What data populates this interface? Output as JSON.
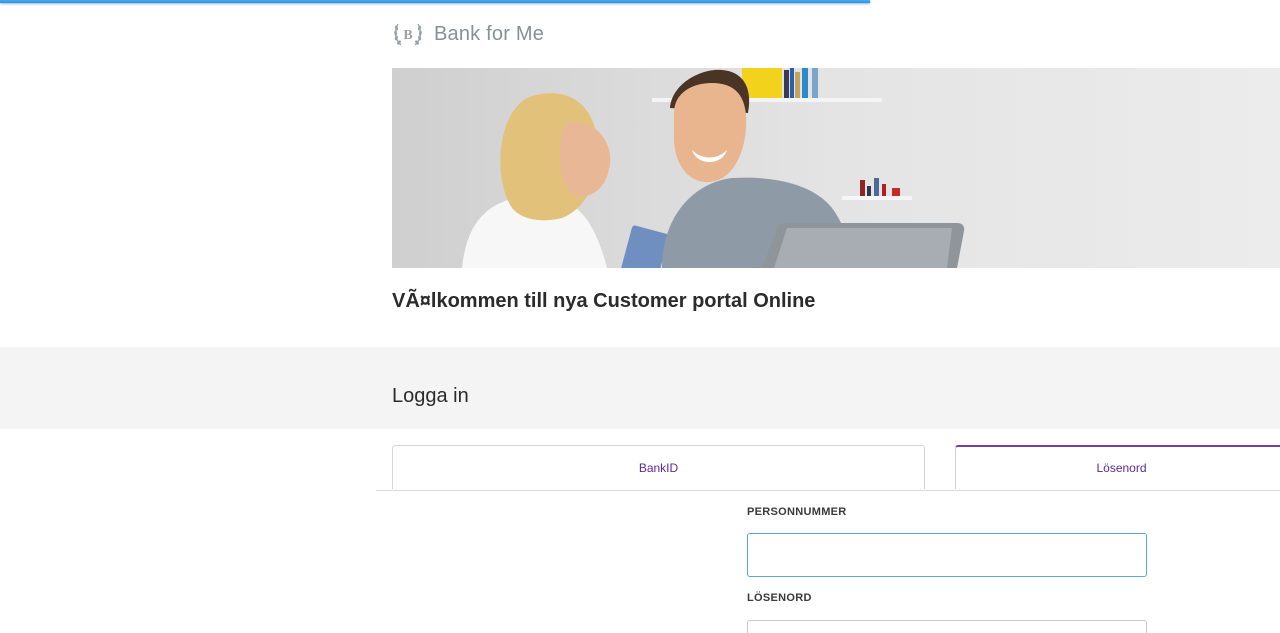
{
  "page": {
    "progress_fraction": 0.68
  },
  "brand": {
    "name": "Bank for Me",
    "emblem_letter": "B",
    "emblem_icon": "laurel-wreath-icon"
  },
  "hero": {
    "image": "couple-with-laptop-and-card-photo"
  },
  "welcome": {
    "heading": "VÃ¤lkommen till nya Customer portal Online"
  },
  "login": {
    "title": "Logga in",
    "tabs": [
      {
        "label": "BankID",
        "active": false
      },
      {
        "label": "Lösenord",
        "active": true
      }
    ],
    "fields": {
      "personnummer": {
        "label": "PERSONNUMMER",
        "value": ""
      },
      "password": {
        "label": "LÖSENORD",
        "value": ""
      }
    }
  },
  "colors": {
    "accent": "#6a3fb0",
    "tab_text": "#5b2a9e",
    "focus": "#5aa7e0",
    "progress": "#2f8fe0"
  }
}
